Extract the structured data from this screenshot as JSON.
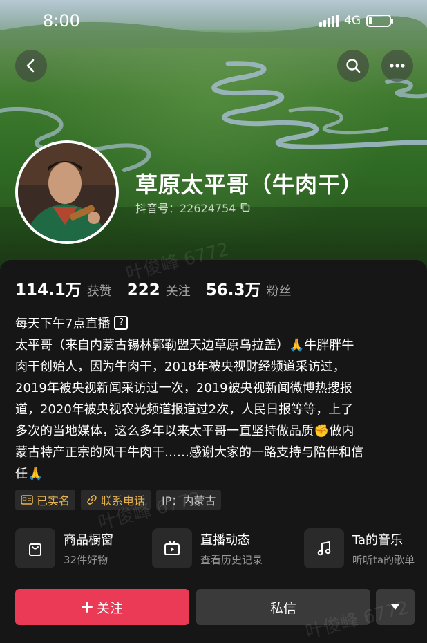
{
  "status_bar": {
    "time": "8:00",
    "network": "4G",
    "battery_level": 0.15
  },
  "header": {
    "back_icon": "chevron-left-icon",
    "search_icon": "search-icon",
    "more_icon": "more-horizontal-icon"
  },
  "profile": {
    "name": "草原太平哥（牛肉干）",
    "id_label": "抖音号：22624754",
    "copy_icon": "copy-icon"
  },
  "stats": [
    {
      "num": "114.1万",
      "label": "获赞"
    },
    {
      "num": "222",
      "label": "关注"
    },
    {
      "num": "56.3万",
      "label": "粉丝"
    }
  ],
  "live_schedule": "每天下午7点直播",
  "bio": {
    "lines": [
      "太平哥（来自内蒙古锡林郭勒盟天边草原乌拉盖）🙏牛胖胖牛",
      "肉干创始人，因为牛肉干，2018年被央视财经频道采访过，",
      "2019年被央视新闻采访过一次，2019被央视新闻微博热搜报",
      "道，2020年被央视农光频道报道过2次，人民日报等等，上了",
      "多次的当地媒体，这么多年以来太平哥一直坚持做品质✊做内",
      "蒙古特产正宗的风干牛肉干……感谢大家的一路支持与陪伴和信",
      "任🙏"
    ]
  },
  "tags": [
    {
      "icon": "id-card-icon",
      "label": "已实名"
    },
    {
      "icon": "link-icon",
      "label": "联系电话"
    },
    {
      "label": "IP：内蒙古"
    }
  ],
  "features": [
    {
      "icon": "shopping-bag-icon",
      "title": "商品橱窗",
      "subtitle": "32件好物"
    },
    {
      "icon": "tv-icon",
      "title": "直播动态",
      "subtitle": "查看历史记录"
    },
    {
      "icon": "music-note-icon",
      "title": "Ta的音乐",
      "subtitle": "听听ta的歌单"
    }
  ],
  "actions": {
    "follow": "关注",
    "message": "私信",
    "dropdown_icon": "caret-down-icon"
  },
  "watermark": "叶俊峰 6772",
  "colors": {
    "accent": "#ea3a55",
    "tag_gold": "#e6b450",
    "panel_bg": "#161616"
  }
}
